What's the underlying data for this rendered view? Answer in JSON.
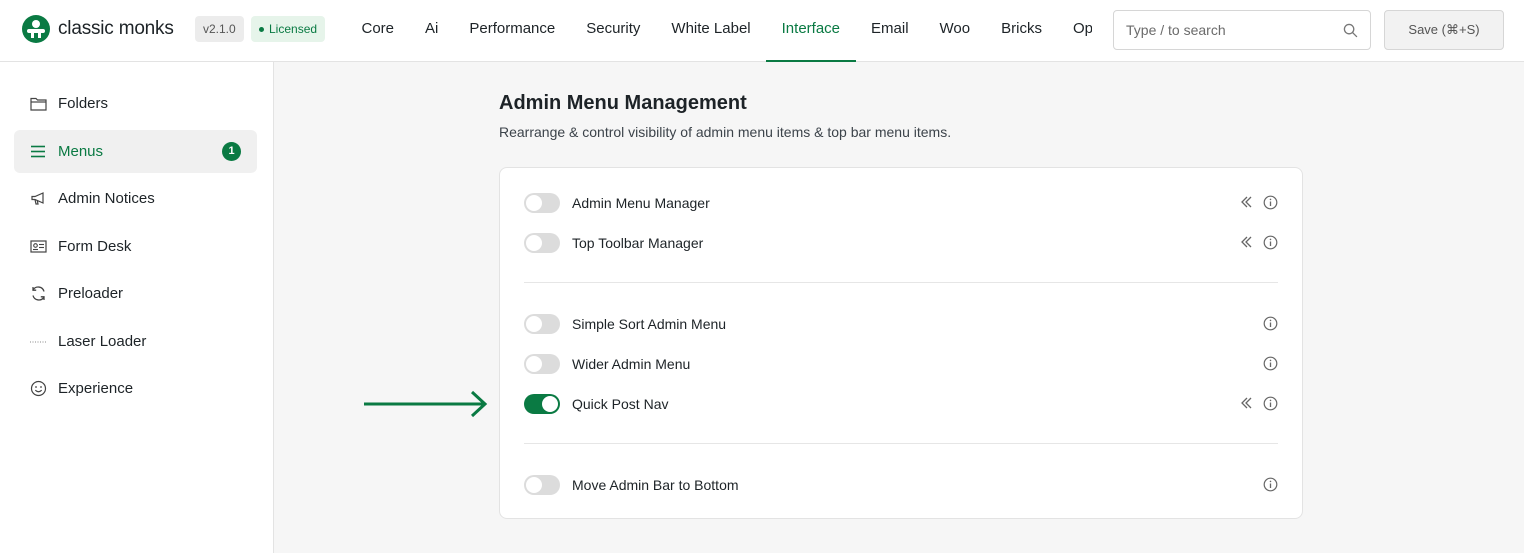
{
  "brand": {
    "name": "classic monks",
    "version": "v2.1.0",
    "license": "Licensed"
  },
  "nav": {
    "tabs": [
      {
        "label": "Core",
        "active": false
      },
      {
        "label": "Ai",
        "active": false
      },
      {
        "label": "Performance",
        "active": false
      },
      {
        "label": "Security",
        "active": false
      },
      {
        "label": "White Label",
        "active": false
      },
      {
        "label": "Interface",
        "active": true
      },
      {
        "label": "Email",
        "active": false
      },
      {
        "label": "Woo",
        "active": false
      },
      {
        "label": "Bricks",
        "active": false
      },
      {
        "label": "Opt",
        "active": false
      }
    ]
  },
  "search": {
    "placeholder": "Type / to search"
  },
  "toolbar": {
    "save_label": "Save (⌘+S)"
  },
  "sidebar": {
    "items": [
      {
        "label": "Folders",
        "icon": "folder-icon",
        "active": false
      },
      {
        "label": "Menus",
        "icon": "hamburger-menu-icon",
        "active": true,
        "badge": "1"
      },
      {
        "label": "Admin Notices",
        "icon": "megaphone-icon",
        "active": false
      },
      {
        "label": "Form Desk",
        "icon": "id-card-icon",
        "active": false
      },
      {
        "label": "Preloader",
        "icon": "refresh-icon",
        "active": false
      },
      {
        "label": "Laser Loader",
        "icon": "dotted-line-icon",
        "active": false
      },
      {
        "label": "Experience",
        "icon": "smiley-icon",
        "active": false
      }
    ]
  },
  "main": {
    "title": "Admin Menu Management",
    "subtitle": "Rearrange & control visibility of admin menu items & top bar menu items.",
    "settings": [
      {
        "label": "Admin Menu Manager",
        "enabled": false,
        "collapsible": true
      },
      {
        "label": "Top Toolbar Manager",
        "enabled": false,
        "collapsible": true
      },
      {
        "label": "Simple Sort Admin Menu",
        "enabled": false,
        "collapsible": false
      },
      {
        "label": "Wider Admin Menu",
        "enabled": false,
        "collapsible": false
      },
      {
        "label": "Quick Post Nav",
        "enabled": true,
        "collapsible": true
      },
      {
        "label": "Move Admin Bar to Bottom",
        "enabled": false,
        "collapsible": false
      }
    ]
  },
  "colors": {
    "accent": "#0a7a43",
    "toggle_off": "#dcdcdc"
  }
}
